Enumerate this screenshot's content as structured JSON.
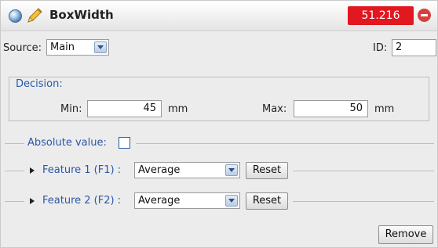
{
  "header": {
    "title": "BoxWidth",
    "value": "51.216",
    "status_icon": "blue-dot-icon",
    "edit_icon": "pencil-icon",
    "remove_icon": "minus-circle-icon",
    "value_color": "#e1181f"
  },
  "source": {
    "label": "Source:",
    "selected": "Main"
  },
  "id": {
    "label": "ID:",
    "value": "2"
  },
  "decision": {
    "legend": "Decision:",
    "min_label": "Min:",
    "min_value": "45",
    "min_unit": "mm",
    "max_label": "Max:",
    "max_value": "50",
    "max_unit": "mm"
  },
  "absolute": {
    "label": "Absolute value:"
  },
  "features": [
    {
      "label": "Feature 1 (F1) :",
      "selected": "Average",
      "reset": "Reset"
    },
    {
      "label": "Feature 2 (F2) :",
      "selected": "Average",
      "reset": "Reset"
    }
  ],
  "footer": {
    "remove_label": "Remove"
  },
  "colors": {
    "link_blue": "#2a58a8",
    "panel_bg": "#ececec"
  }
}
